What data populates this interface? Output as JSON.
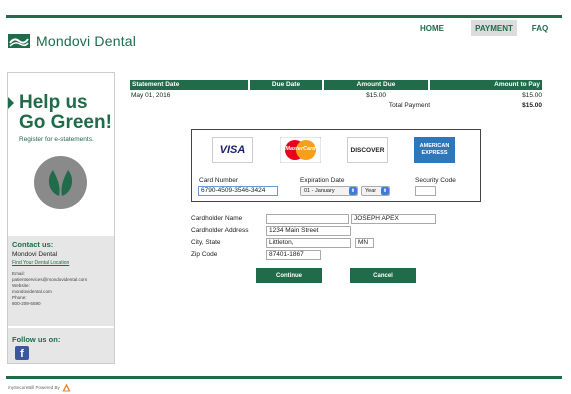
{
  "brand": {
    "name": "Mondovi Dental"
  },
  "nav": [
    "HOME",
    "PAYMENT",
    "FAQ"
  ],
  "sidebar": {
    "promo_line1": "Help us",
    "promo_line2": "Go Green!",
    "promo_sub": "Register for e-statements.",
    "contact_heading": "Contact us:",
    "contact_name": "Mondovi Dental",
    "contact_link": "Find Your Dental Location",
    "email_label": "Email:",
    "email_value": "patientservices@mondovidental.com",
    "website_label": "Website:",
    "website_value": "mondovidental.com",
    "phone_label": "Phone:",
    "phone_value": "800-209-5590",
    "follow_heading": "Follow us on:"
  },
  "statement": {
    "headers": [
      "Statement Date",
      "Due Date",
      "Amount Due",
      "Amount to Pay"
    ],
    "row": {
      "statement_date": "May 01, 2016",
      "due_date": "",
      "amount_due": "$15.00",
      "amount_to_pay": "$15.00"
    },
    "total_label": "Total Payment",
    "total_value": "$15.00"
  },
  "cards": [
    "VISA",
    "MasterCard",
    "DISCOVER",
    "AMERICAN EXPRESS"
  ],
  "payment_form": {
    "card_number_label": "Card Number",
    "card_number_value": "6790-4509-3546-3424",
    "expiration_label": "Expiration Date",
    "exp_month": "01 - January",
    "exp_year": "Year",
    "security_label": "Security Code",
    "security_value": ""
  },
  "billing_form": {
    "holder_label": "Cardholder Name",
    "holder_first": "",
    "holder_last": "JOSEPH APEX",
    "address_label": "Cardholder Address",
    "address_value": "1234 Main Street",
    "citystate_label": "City, State",
    "city_value": "Littleton,",
    "state_value": "MN",
    "zip_label": "Zip Code",
    "zip_value": "87401-1867"
  },
  "buttons": {
    "continue": "Continue",
    "cancel": "Cancel"
  },
  "footer": {
    "powered": "mySecureBill Powered By"
  },
  "colors": {
    "brand_green": "#1f6b4a",
    "facebook_blue": "#3b5998"
  }
}
